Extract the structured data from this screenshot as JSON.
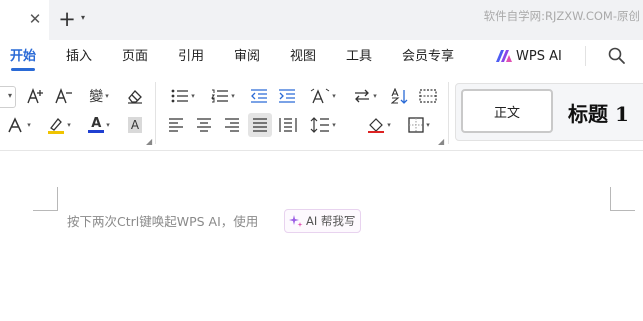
{
  "window": {
    "watermark": "软件自学网:RJZXW.COM-原创",
    "tab_close_glyph": "✕",
    "new_tab_glyph": "+",
    "dropdown_glyph": "▾"
  },
  "menu": {
    "start": "开始",
    "insert": "插入",
    "page": "页面",
    "reference": "引用",
    "review": "审阅",
    "view": "视图",
    "tools": "工具",
    "member": "会员专享",
    "wps_ai": "WPS AI",
    "active": "开始",
    "accent_color": "#2a6ad6"
  },
  "ribbon": {
    "font_row_icons": [
      "font-size-increase-icon",
      "font-size-decrease-icon",
      "phonetic-guide-icon",
      "clear-format-icon"
    ],
    "increase_font": "A⁺",
    "decrease_font": "A⁻",
    "phonetic": "變",
    "font_color_letter": "A",
    "char_shading_letter": "A",
    "highlight_color": "#f0c400",
    "font_color": "#1f3fd1",
    "paragraph_icons": [
      "bullet-list-icon",
      "numbered-list-icon",
      "decrease-indent-icon",
      "increase-indent-icon",
      "chinese-layout-icon",
      "text-direction-icon",
      "sort-icon",
      "borders-icon"
    ],
    "alignment_icons": [
      "align-left-icon",
      "align-center-icon",
      "align-right-icon",
      "justify-icon",
      "distributed-icon",
      "line-spacing-icon"
    ],
    "active_alignment": "justify",
    "styles": {
      "normal": "正文",
      "heading1": "标题 1"
    }
  },
  "document": {
    "hint": "按下两次Ctrl键唤起WPS AI，使用",
    "ai_chip": "AI 帮我写"
  }
}
